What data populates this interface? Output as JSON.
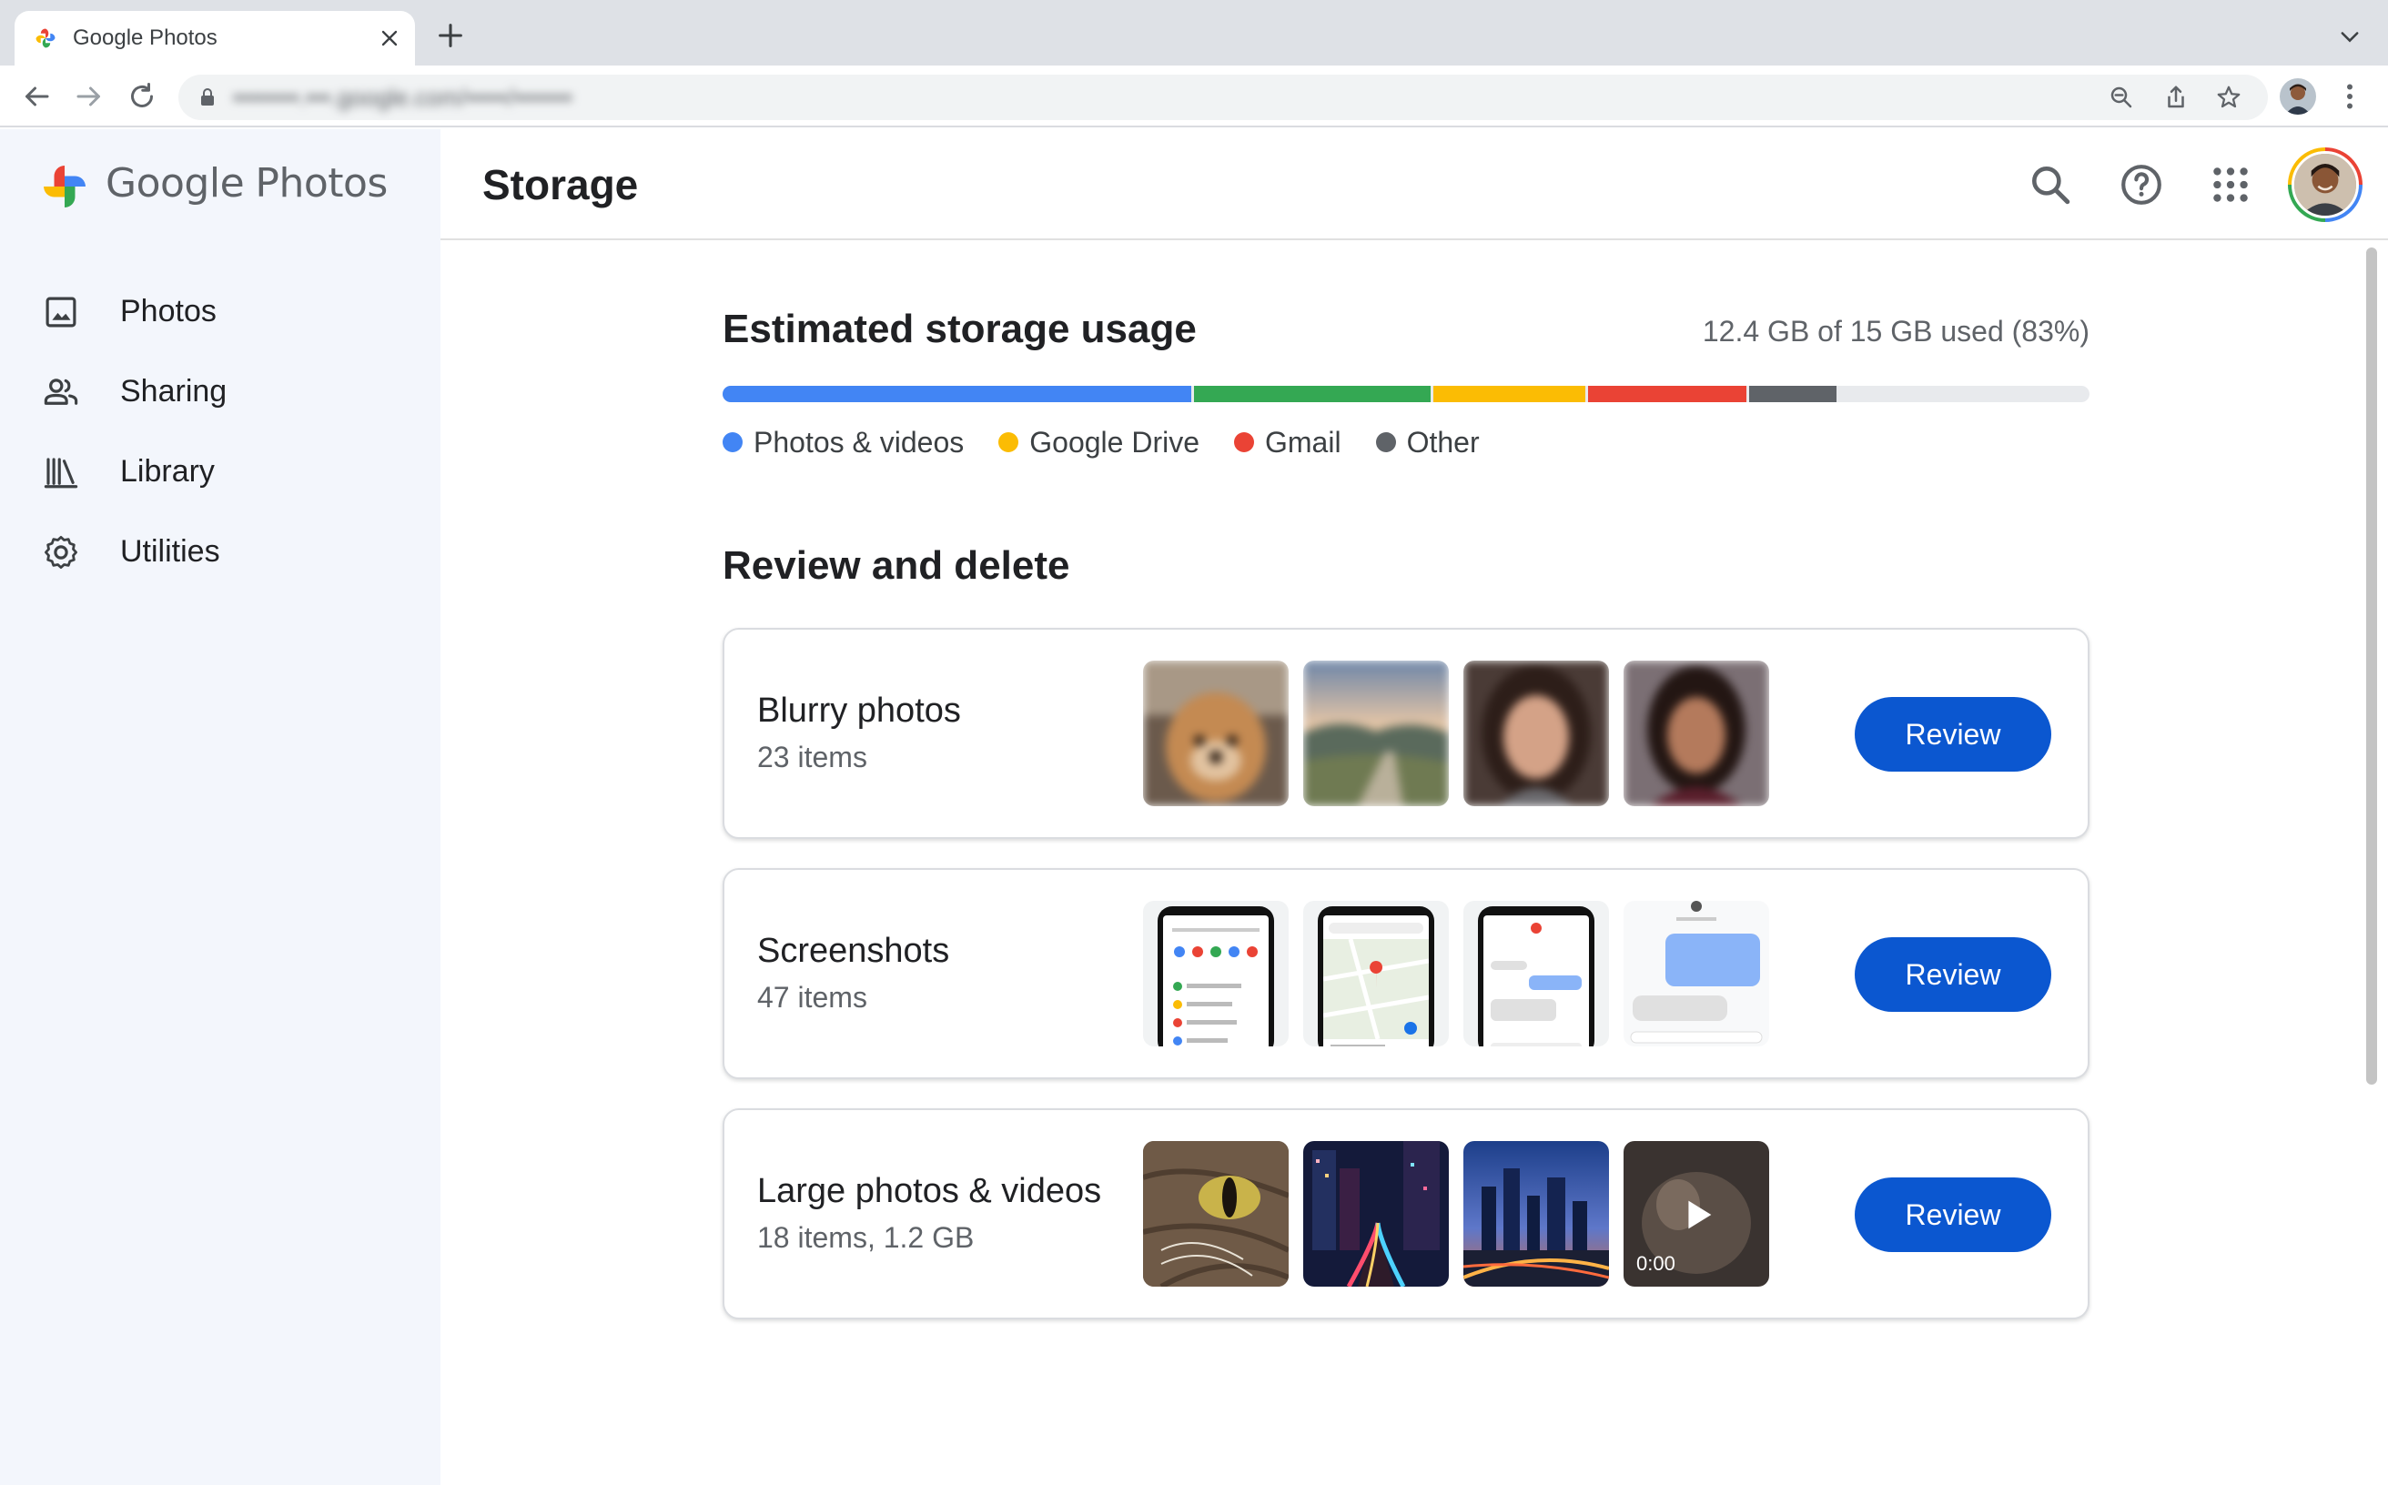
{
  "browser": {
    "tab_title": "Google Photos",
    "url": "••••••••.•••.google.com/•••••/•••••••"
  },
  "brand": {
    "google": "Google",
    "photos": "Photos"
  },
  "sidenav": {
    "items": [
      {
        "label": "Photos",
        "icon": "photo-icon"
      },
      {
        "label": "Sharing",
        "icon": "people-icon"
      },
      {
        "label": "Library",
        "icon": "library-icon"
      },
      {
        "label": "Utilities",
        "icon": "gear-icon"
      }
    ]
  },
  "header": {
    "title": "Storage"
  },
  "storage": {
    "title": "Estimated storage usage",
    "used_text": "12.4 GB of 15 GB used (83%)",
    "used_percent": 83,
    "segments": [
      {
        "name": "Photos & videos",
        "color": "#4285f4",
        "percent": 34.5
      },
      {
        "name": "Google Drive",
        "color": "#34a853",
        "percent": 17.5
      },
      {
        "name": "Google Drive",
        "color": "#fbbc04",
        "percent": 11.3
      },
      {
        "name": "Gmail",
        "color": "#ea4335",
        "percent": 11.8
      },
      {
        "name": "Other",
        "color": "#5f6368",
        "percent": 6.6
      }
    ],
    "legend": [
      {
        "label": "Photos & videos",
        "color": "#4285f4"
      },
      {
        "label": "Google Drive",
        "color": "#fbbc04"
      },
      {
        "label": "Gmail",
        "color": "#ea4335"
      },
      {
        "label": "Other",
        "color": "#5f6368"
      }
    ]
  },
  "review": {
    "title": "Review and delete",
    "cards": [
      {
        "title": "Blurry photos",
        "subtitle": "23 items",
        "button": "Review"
      },
      {
        "title": "Screenshots",
        "subtitle": "47 items",
        "button": "Review"
      },
      {
        "title": "Large photos & videos",
        "subtitle": "18 items, 1.2 GB",
        "button": "Review",
        "video_duration": "0:00"
      }
    ]
  },
  "colors": {
    "accent": "#0b57d0",
    "sidenav_bg": "#f3f6fc"
  }
}
